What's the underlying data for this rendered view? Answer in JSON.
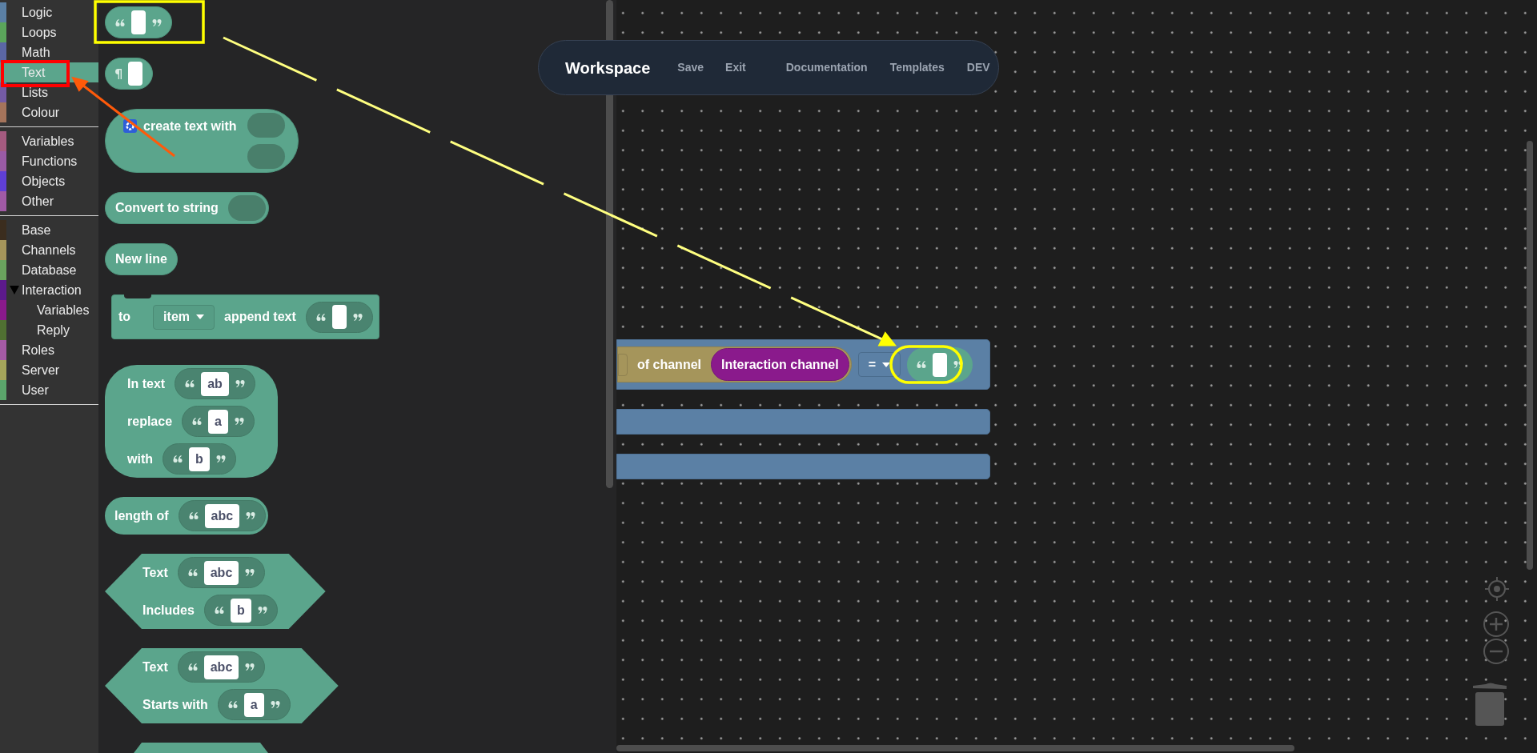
{
  "sidebar": {
    "groups": [
      {
        "items": [
          {
            "label": "Logic",
            "color": "#5b80a5",
            "selected": false
          },
          {
            "label": "Loops",
            "color": "#5ba55b",
            "selected": false
          },
          {
            "label": "Math",
            "color": "#5b67a5",
            "selected": false
          },
          {
            "label": "Text",
            "color": "#5ba58c",
            "selected": true
          },
          {
            "label": "Lists",
            "color": "#745ba5",
            "selected": false
          },
          {
            "label": "Colour",
            "color": "#a5745b",
            "selected": false
          }
        ]
      },
      {
        "items": [
          {
            "label": "Variables",
            "color": "#a55b80",
            "selected": false
          },
          {
            "label": "Functions",
            "color": "#995ba5",
            "selected": false
          },
          {
            "label": "Objects",
            "color": "#5f3fd6",
            "selected": false
          },
          {
            "label": "Other",
            "color": "#a05aa5",
            "selected": false
          }
        ]
      },
      {
        "items": [
          {
            "label": "Base",
            "color": "#3b2d1e",
            "selected": false
          },
          {
            "label": "Channels",
            "color": "#a5955b",
            "selected": false
          },
          {
            "label": "Database",
            "color": "#6aa35e",
            "selected": false
          },
          {
            "label": "Interaction",
            "color": "#5c1a8c",
            "selected": false,
            "expanded": true,
            "children": [
              {
                "label": "Variables",
                "color": "#8a1a8c",
                "selected": false
              },
              {
                "label": "Reply",
                "color": "#507032",
                "selected": false
              }
            ]
          },
          {
            "label": "Roles",
            "color": "#a55ba5",
            "selected": false
          },
          {
            "label": "Server",
            "color": "#a5a55b",
            "selected": false
          },
          {
            "label": "User",
            "color": "#5ba56b",
            "selected": false
          }
        ]
      }
    ]
  },
  "header": {
    "title": "Workspace",
    "actions": [
      "Save",
      "Exit"
    ],
    "links": [
      "Documentation",
      "Templates",
      "DEV"
    ]
  },
  "flyout": {
    "blocks": [
      {
        "kind": "text_literal"
      },
      {
        "kind": "multiline_literal"
      },
      {
        "kind": "join",
        "label": "create text with"
      },
      {
        "kind": "convert",
        "label": "Convert to string"
      },
      {
        "kind": "plain",
        "label": "New line"
      },
      {
        "kind": "append",
        "label": "to",
        "variable": "item",
        "action": "append text"
      },
      {
        "kind": "round_rows",
        "rows": [
          {
            "label": "In text",
            "value": "ab"
          },
          {
            "label": "replace",
            "value": "a"
          },
          {
            "label": "with",
            "value": "b"
          }
        ]
      },
      {
        "kind": "round_rows",
        "rows": [
          {
            "label": "length of",
            "value": "abc"
          }
        ]
      },
      {
        "kind": "hex_rows",
        "rows": [
          {
            "label": "Text",
            "value": "abc"
          },
          {
            "label": "Includes",
            "value": "b"
          }
        ]
      },
      {
        "kind": "hex_rows",
        "rows": [
          {
            "label": "Text",
            "value": "abc"
          },
          {
            "label": "Starts with",
            "value": "a"
          }
        ]
      },
      {
        "kind": "cut_off"
      }
    ]
  },
  "workspace": {
    "blocks": [
      {
        "kind": "compare",
        "label": "of channel",
        "channel": "Interaction channel",
        "operator": "="
      },
      {
        "kind": "empty"
      },
      {
        "kind": "empty"
      }
    ]
  }
}
